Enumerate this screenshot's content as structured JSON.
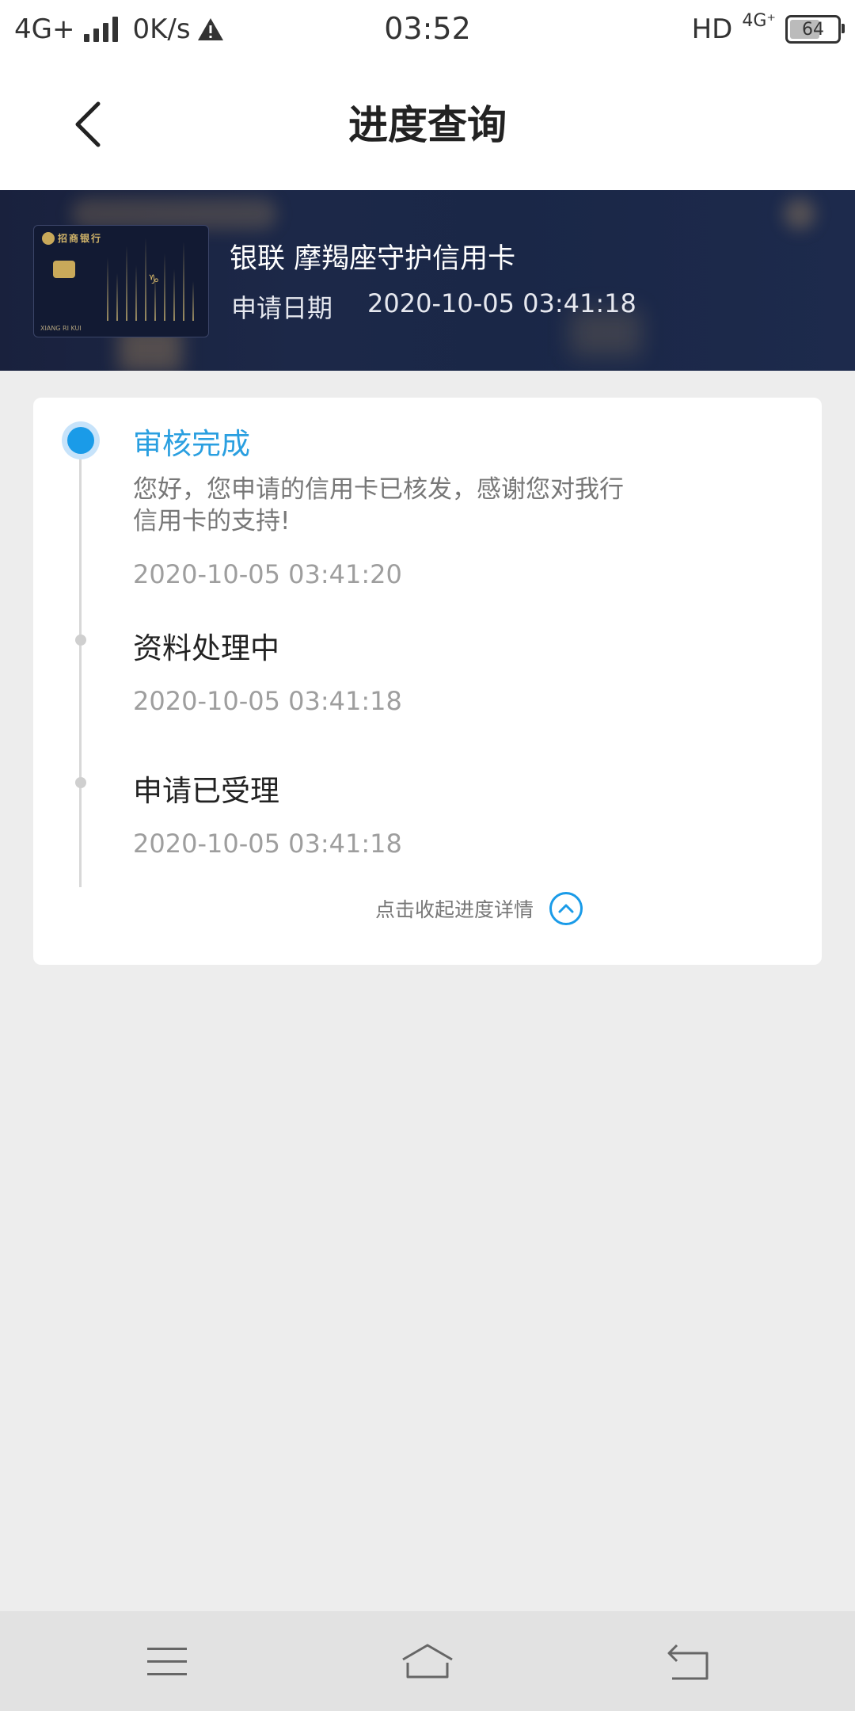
{
  "status_bar": {
    "network": "4G+",
    "speed": "0K/s",
    "time": "03:52",
    "hd": "HD",
    "network_right": "4G⁺",
    "battery": "64"
  },
  "header": {
    "title": "进度查询"
  },
  "card": {
    "title": "银联 摩羯座守护信用卡",
    "apply_label": "申请日期",
    "apply_date": "2020-10-05 03:41:18",
    "bank_name": "招商银行",
    "cardholder_text": "XIANG RI KUI",
    "zodiac_sign": "♑"
  },
  "steps": [
    {
      "title": "审核完成",
      "message": "您好，您申请的信用卡已核发，感谢您对我行信用卡的支持!",
      "time": "2020-10-05 03:41:20"
    },
    {
      "title": "资料处理中",
      "time": "2020-10-05 03:41:18"
    },
    {
      "title": "申请已受理",
      "time": "2020-10-05 03:41:18"
    }
  ],
  "collapse": {
    "label": "点击收起进度详情"
  },
  "colors": {
    "accent": "#1a9be8",
    "banner": "#1c2848"
  }
}
